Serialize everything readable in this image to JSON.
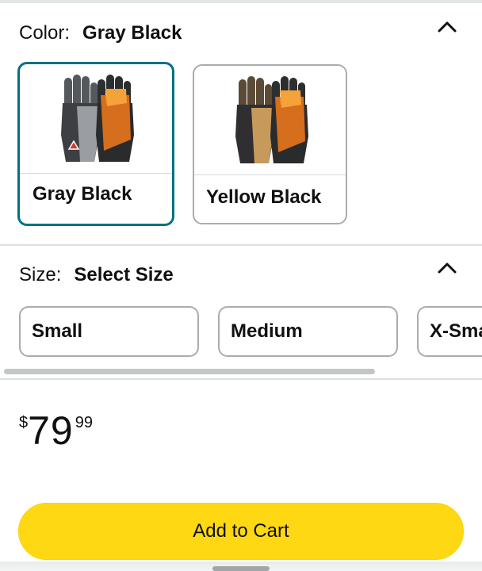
{
  "color": {
    "label": "Color:",
    "selected": "Gray Black",
    "options": [
      {
        "name": "Gray Black",
        "selected": true,
        "left_color": "#8a8c8f",
        "right_color": "#e8761c"
      },
      {
        "name": "Yellow Black",
        "selected": false,
        "left_color": "#c79a5c",
        "right_color": "#e8761c"
      }
    ],
    "selected_border": "#007185"
  },
  "size": {
    "label": "Size:",
    "selected": "Select Size",
    "options": [
      "Small",
      "Medium",
      "X-Small"
    ]
  },
  "price": {
    "symbol": "$",
    "whole": "79",
    "fraction": "99"
  },
  "cart": {
    "label": "Add to Cart",
    "color": "#ffd814"
  },
  "icons": {
    "color_collapse": "chevron-up-icon",
    "size_collapse": "chevron-up-icon"
  }
}
